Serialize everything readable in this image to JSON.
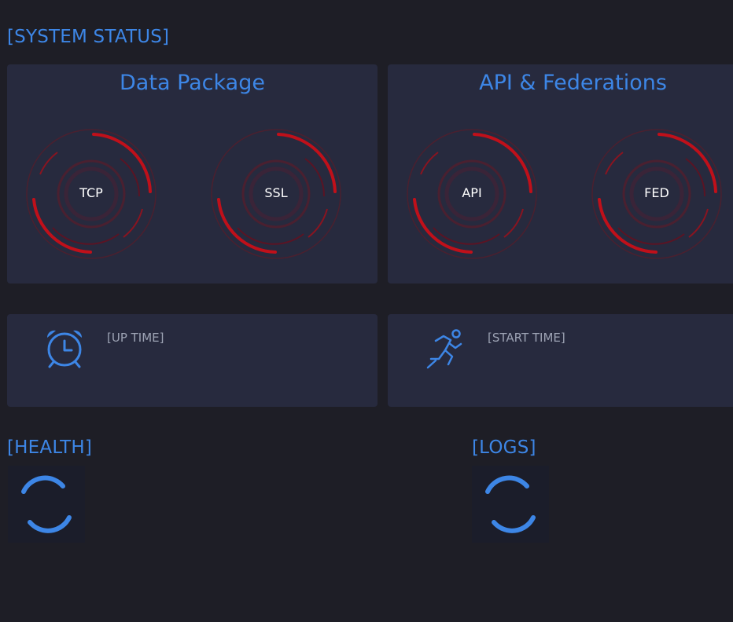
{
  "header": {
    "title": "[SYSTEM STATUS]"
  },
  "panels": [
    {
      "title": "Data Package",
      "gauges": [
        {
          "label": "TCP"
        },
        {
          "label": "SSL"
        }
      ]
    },
    {
      "title": "API & Federations",
      "gauges": [
        {
          "label": "API"
        },
        {
          "label": "FED"
        }
      ]
    }
  ],
  "info": [
    {
      "label": "[UP TIME]",
      "icon": "alarm-clock-icon"
    },
    {
      "label": "[START TIME]",
      "icon": "running-person-icon"
    }
  ],
  "health": {
    "title": "[HEALTH]",
    "icon": "loading-spinner-icon"
  },
  "logs": {
    "title": "[LOGS]",
    "icon": "loading-spinner-icon"
  },
  "colors": {
    "accent": "#3d86e6",
    "gauge_red": "#c0101a",
    "panel_bg": "#272a3e",
    "page_bg": "#1e1e26"
  }
}
